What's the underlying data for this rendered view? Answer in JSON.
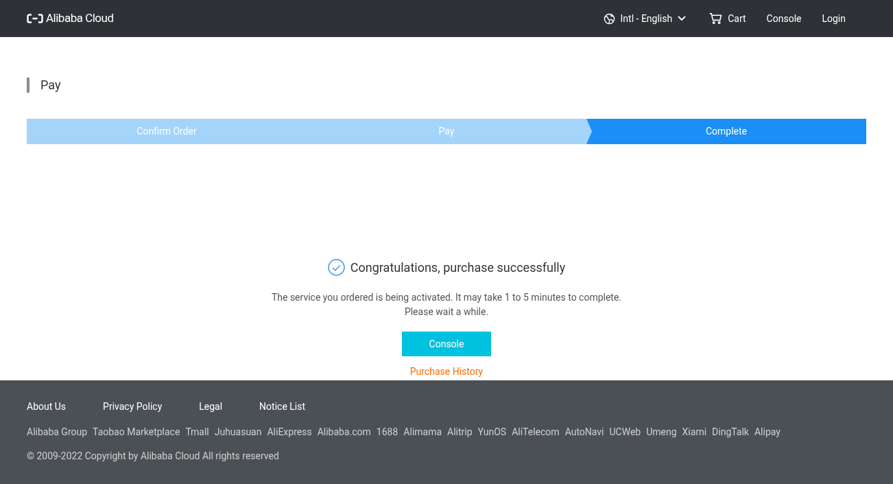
{
  "header": {
    "logo": "Alibaba Cloud",
    "language": "Intl - English",
    "nav": [
      "Cart",
      "Console",
      "Login"
    ]
  },
  "page_title": "Pay",
  "steps": [
    {
      "label": "Confirm Order",
      "selected": false
    },
    {
      "label": "Pay",
      "selected": false
    },
    {
      "label": "Complete",
      "selected": true
    }
  ],
  "result": {
    "title": "Congratulations, purchase successfully",
    "message": [
      "The service you ordered is being activated. It may take 1 to 5 minutes to complete.",
      "Please wait a while."
    ],
    "button": "Console",
    "link": "Purchase History"
  },
  "footer": {
    "links": [
      "About Us",
      "Privacy Policy",
      "Legal",
      "Notice List"
    ],
    "sites": [
      "Alibaba Group",
      "Taobao Marketplace",
      "Tmall",
      "Juhuasuan",
      "AliExpress",
      "Alibaba.com",
      "1688",
      "Alimama",
      "Alitrip",
      "YunOS",
      "AliTelecom",
      "AutoNavi",
      "UCWeb",
      "Umeng",
      "Xiami",
      "DingTalk",
      "Alipay"
    ],
    "copyright": "© 2009-2022 Copyright by Alibaba Cloud All rights reserved"
  }
}
